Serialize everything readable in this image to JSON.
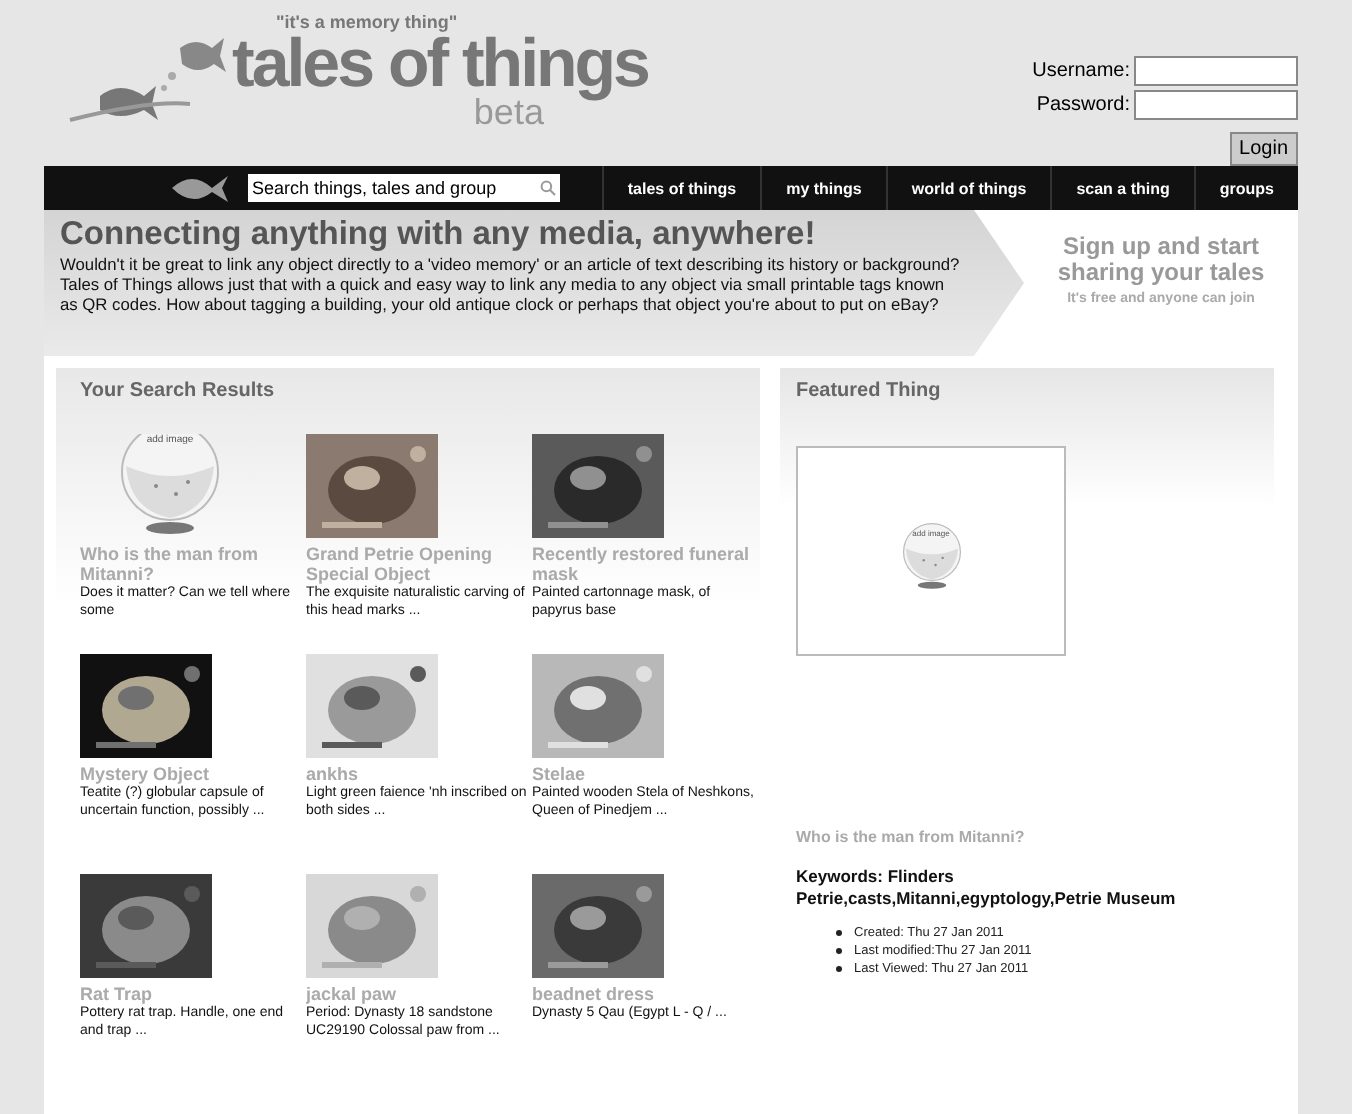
{
  "header": {
    "tagline": "\"it's a memory thing\"",
    "logo_title": "tales of things",
    "logo_subtitle": "beta"
  },
  "login": {
    "username_label": "Username:",
    "password_label": "Password:",
    "button": "Login"
  },
  "navbar": {
    "search": {
      "placeholder": "Search things, tales and group"
    },
    "links": [
      "tales of things",
      "my things",
      "world of things",
      "scan a thing",
      "groups"
    ]
  },
  "banner": {
    "heading": "Connecting anything with any media, anywhere!",
    "text": "Wouldn't it be great to link any object directly to a 'video memory' or an article of text describing its history or background? Tales of Things allows just that with a quick and easy way to link any media to any object via small printable tags known as QR codes. How about tagging a building, your old antique clock or perhaps that object you're about to put on eBay?",
    "signup_heading": "Sign up and start sharing your tales",
    "signup_note": "It's free and anyone can join"
  },
  "search_results": {
    "title": "Your Search Results",
    "items": [
      {
        "kind": "placeholder",
        "placeholder_label": "add image",
        "title": "Who is the man from Mitanni?",
        "description": "Does it matter? Can we tell where some"
      },
      {
        "title": "Grand Petrie Opening Special Object",
        "description": "The exquisite naturalistic carving of this head marks ..."
      },
      {
        "title": "Recently restored funeral mask",
        "description": "Painted cartonnage mask, of papyrus base"
      },
      {
        "title": "Mystery Object",
        "description": "Teatite (?) globular capsule of uncertain function, possibly ..."
      },
      {
        "title": "ankhs",
        "description": "Light green faience 'nh inscribed on both sides ..."
      },
      {
        "title": "Stelae",
        "description": "Painted wooden Stela of Neshkons, Queen of Pinedjem ..."
      },
      {
        "title": "Rat Trap",
        "description": "Pottery rat trap. Handle, one end and trap ..."
      },
      {
        "title": "jackal paw",
        "description": "Period: Dynasty 18 sandstone UC29190 Colossal paw from ..."
      },
      {
        "title": "beadnet dress",
        "description": "Dynasty 5 Qau (Egypt L - Q / ..."
      }
    ]
  },
  "featured": {
    "title": "Featured Thing",
    "placeholder_label": "add image",
    "item_title": "Who is the man from Mitanni?",
    "keywords": "Keywords: Flinders Petrie,casts,Mitanni,egyptology,Petrie Museum",
    "meta": [
      "Created: Thu 27 Jan 2011",
      "Last modified:Thu 27 Jan 2011",
      "Last Viewed: Thu 27 Jan 2011"
    ]
  }
}
